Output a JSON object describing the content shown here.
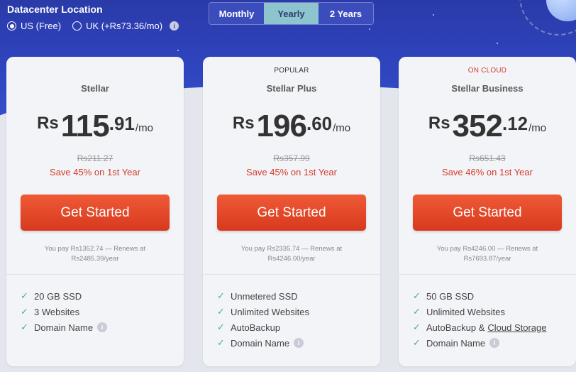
{
  "datacenter": {
    "title": "Datacenter Location",
    "options": [
      {
        "label": "US (Free)",
        "selected": true
      },
      {
        "label": "UK (+Rs73.36/mo)",
        "selected": false
      }
    ],
    "info_icon": "i"
  },
  "billing": {
    "options": [
      "Monthly",
      "Yearly",
      "2 Years"
    ],
    "selected": "Yearly"
  },
  "colors": {
    "accent_button": "#e14a2b",
    "save_text": "#d23c2c",
    "check": "#4aa6b0",
    "toggle_active": "#8dc4cd",
    "hero": "#2f45c0"
  },
  "plans": [
    {
      "tag": "",
      "name": "Stellar",
      "currency": "Rs",
      "price_whole": "115",
      "price_frac": ".91",
      "per": "/mo",
      "old_price": "Rs211.27",
      "save": "Save 45% on 1st Year",
      "button": "Get Started",
      "pay_line": "You pay Rs1352.74 — Renews at Rs2485.39/year",
      "features": [
        {
          "text": "20 GB SSD",
          "icon": "check-icon"
        },
        {
          "text": "3 Websites",
          "icon": "check-icon"
        },
        {
          "text": "Domain Name",
          "icon": "check-icon",
          "info": "i"
        }
      ]
    },
    {
      "tag": "POPULAR",
      "name": "Stellar Plus",
      "currency": "Rs",
      "price_whole": "196",
      "price_frac": ".60",
      "per": "/mo",
      "old_price": "Rs357.99",
      "save": "Save 45% on 1st Year",
      "button": "Get Started",
      "pay_line": "You pay Rs2335.74 — Renews at Rs4246.00/year",
      "features": [
        {
          "text": "Unmetered SSD",
          "icon": "check-icon"
        },
        {
          "text": "Unlimited Websites",
          "icon": "check-icon"
        },
        {
          "text": "AutoBackup",
          "icon": "check-icon"
        },
        {
          "text": "Domain Name",
          "icon": "check-icon",
          "info": "i"
        }
      ]
    },
    {
      "tag": "ON CLOUD",
      "name": "Stellar Business",
      "currency": "Rs",
      "price_whole": "352",
      "price_frac": ".12",
      "per": "/mo",
      "old_price": "Rs651.43",
      "save": "Save 46% on 1st Year",
      "button": "Get Started",
      "pay_line": "You pay Rs4246.00 — Renews at Rs7693.87/year",
      "features": [
        {
          "text": "50 GB SSD",
          "icon": "check-icon"
        },
        {
          "text": "Unlimited Websites",
          "icon": "check-icon"
        },
        {
          "text": "AutoBackup &",
          "icon": "check-icon",
          "link": "Cloud Storage"
        },
        {
          "text": "Domain Name",
          "icon": "check-icon",
          "info": "i"
        }
      ]
    }
  ]
}
